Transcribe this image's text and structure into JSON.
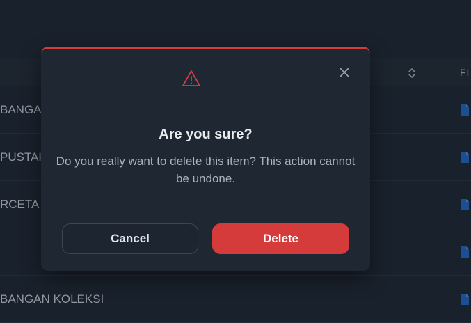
{
  "table": {
    "header_files_label": "FI",
    "rows": [
      {
        "text": "BANGA"
      },
      {
        "text": "PUSTAK"
      },
      {
        "text": "RCETA"
      },
      {
        "text": ""
      },
      {
        "text": "BANGAN KOLEKSI"
      }
    ]
  },
  "modal": {
    "title": "Are you sure?",
    "message": "Do you really want to delete this item? This action cannot be undone.",
    "cancel_label": "Cancel",
    "delete_label": "Delete",
    "icons": {
      "warning": "warning-triangle-icon",
      "close": "close-icon",
      "file": "file-icon",
      "sort": "sort-icon"
    }
  },
  "colors": {
    "accent_danger": "#d63b3b",
    "background": "#1e2733",
    "file_icon": "#1f6fd1"
  }
}
